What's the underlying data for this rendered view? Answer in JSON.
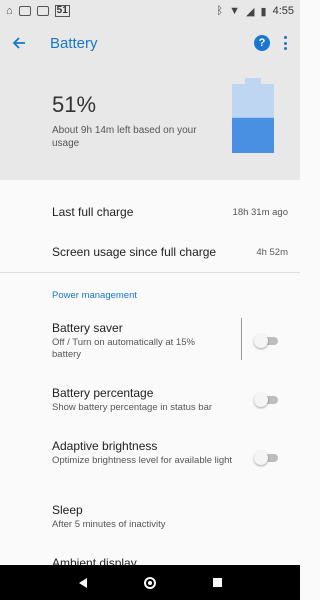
{
  "status_bar": {
    "signal_badge": "51",
    "time": "4:55",
    "icons": [
      "home-icon",
      "photo-icon",
      "message-icon",
      "bluetooth-icon",
      "wifi-icon",
      "cell-signal-icon",
      "battery-icon"
    ]
  },
  "app_bar": {
    "title": "Battery",
    "icons": [
      "back-arrow-icon",
      "help-icon",
      "more-vert-icon"
    ]
  },
  "summary": {
    "percentage": "51%",
    "estimate": "About 9h 14m left based on your usage",
    "battery_level": 0.51,
    "battery_colors": {
      "fill": "#4a90e2",
      "empty": "#bfd6f2"
    }
  },
  "usage": {
    "last_full_charge": {
      "label": "Last full charge",
      "value": "18h 31m ago"
    },
    "screen_usage": {
      "label": "Screen usage since full charge",
      "value": "4h 52m"
    }
  },
  "power_management": {
    "header": "Power management",
    "items": [
      {
        "title": "Battery saver",
        "subtitle": "Off / Turn on automatically at 15% battery",
        "toggle_on": false
      },
      {
        "title": "Battery percentage",
        "subtitle": "Show battery percentage in status bar",
        "toggle_on": false
      },
      {
        "title": "Adaptive brightness",
        "subtitle": "Optimize brightness level for available light",
        "toggle_on": false
      },
      {
        "title": "Sleep",
        "subtitle": "After 5 minutes of inactivity"
      },
      {
        "title": "Ambient display"
      }
    ]
  },
  "colors": {
    "accent": "#1976d2",
    "header_bg": "#e8e8e8",
    "page_bg": "#fafafa"
  }
}
